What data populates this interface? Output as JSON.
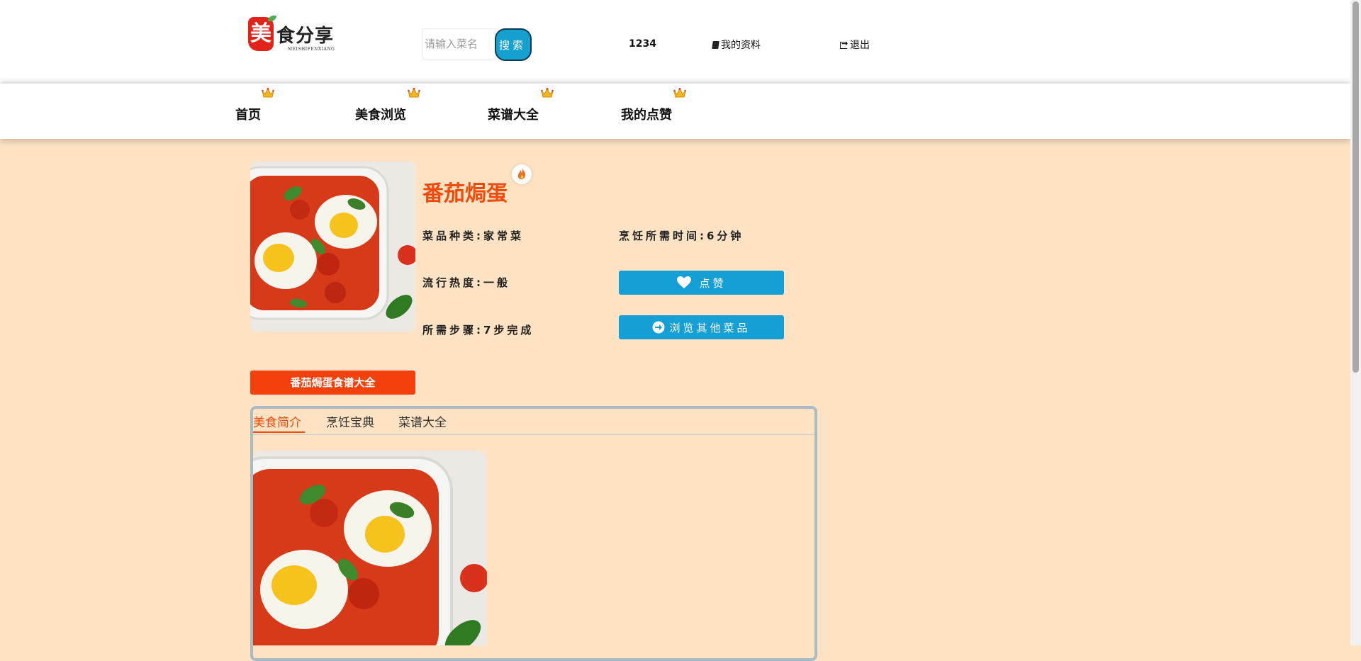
{
  "header": {
    "logo_char": "美",
    "logo_text": "食分享",
    "logo_sub": "MEISHIFENXIANG",
    "search_placeholder": "请输入菜名",
    "search_button": "搜索",
    "user_id": "1234",
    "profile_label": "我的资料",
    "logout_label": "退出",
    "profile_icon": "book-icon",
    "logout_icon": "sign-out-icon"
  },
  "nav": {
    "items": [
      {
        "label": "首页",
        "icon": "crown-icon"
      },
      {
        "label": "美食浏览",
        "icon": "crown-icon"
      },
      {
        "label": "菜谱大全",
        "icon": "crown-icon"
      },
      {
        "label": "我的点赞",
        "icon": "crown-icon"
      }
    ]
  },
  "dish": {
    "title": "番茄焗蛋",
    "hot_icon": "fire-icon",
    "category": "菜品种类:家常菜",
    "cook_time": "烹饪所需时间:6分钟",
    "popularity": "流行热度:一般",
    "steps": "所需步骤:7步完成",
    "like_button": "点赞",
    "browse_button": "浏览其他菜品",
    "recipe_tag": "番茄焗蛋食谱大全"
  },
  "tabs": [
    {
      "label": "美食简介",
      "active": true
    },
    {
      "label": "烹饪宝典",
      "active": false
    },
    {
      "label": "菜谱大全",
      "active": false
    }
  ],
  "colors": {
    "accent": "#f04a0c",
    "button_blue": "#169fd4",
    "page_bg": "#fde3c3"
  }
}
